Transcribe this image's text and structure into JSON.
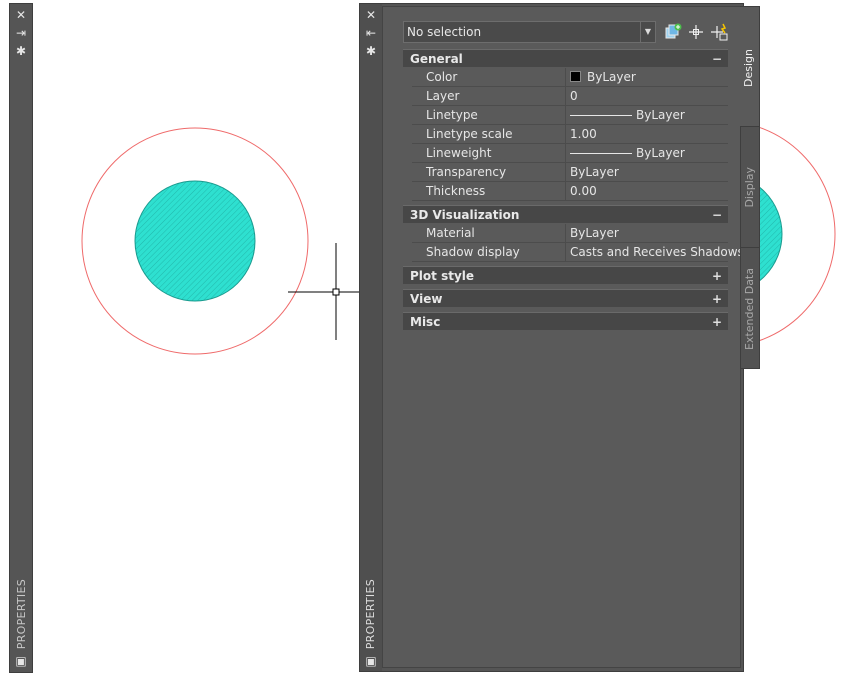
{
  "left_palette": {
    "label": "PROPERTIES",
    "icons": [
      "close-icon",
      "auto-hide-icon",
      "settings-icon",
      "palette-menu-icon"
    ]
  },
  "main_palette": {
    "label": "PROPERTIES",
    "icons": [
      "close-icon",
      "auto-hide-icon",
      "settings-icon",
      "palette-menu-icon"
    ],
    "selector": {
      "value": "No selection"
    },
    "toolbar": [
      "toggle-pickadd-icon",
      "select-objects-icon",
      "quick-select-icon"
    ],
    "sections": [
      {
        "title": "General",
        "toggle": "−",
        "rows": [
          {
            "name": "Color",
            "value": "ByLayer"
          },
          {
            "name": "Layer",
            "value": "0"
          },
          {
            "name": "Linetype",
            "value": "ByLayer"
          },
          {
            "name": "Linetype scale",
            "value": "1.00"
          },
          {
            "name": "Lineweight",
            "value": "ByLayer"
          },
          {
            "name": "Transparency",
            "value": "ByLayer"
          },
          {
            "name": "Thickness",
            "value": "0.00"
          }
        ]
      },
      {
        "title": "3D Visualization",
        "toggle": "−",
        "rows": [
          {
            "name": "Material",
            "value": "ByLayer"
          },
          {
            "name": "Shadow display",
            "value": "Casts and Receives Shadows"
          }
        ]
      },
      {
        "title": "Plot style",
        "toggle": "+"
      },
      {
        "title": "View",
        "toggle": "+"
      },
      {
        "title": "Misc",
        "toggle": "+"
      }
    ],
    "tabs": [
      "Design",
      "Display",
      "Extended Data"
    ]
  },
  "colors": {
    "circle_stroke": "#ef6a6a",
    "hatch_fill": "#2ee0d0",
    "palette_bg": "#555555"
  }
}
